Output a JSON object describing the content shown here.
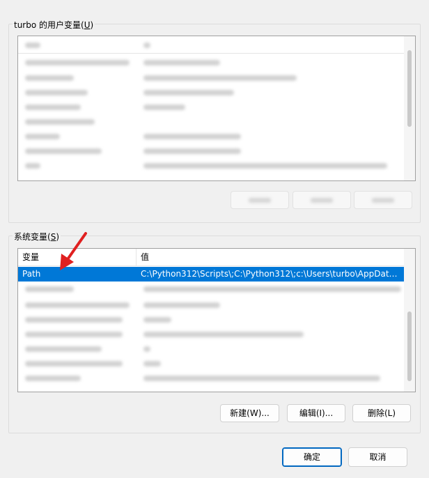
{
  "user_vars": {
    "group_label": "turbo 的用户变量(",
    "group_hotkey": "U",
    "group_label_end": ")"
  },
  "system_vars": {
    "group_label": "系统变量(",
    "group_hotkey": "S",
    "group_label_end": ")",
    "columns": {
      "name": "变量",
      "value": "值"
    },
    "selected_row": {
      "name": "Path",
      "value": "C:\\Python312\\Scripts\\;C:\\Python312\\;c:\\Users\\turbo\\AppData\\..."
    },
    "buttons": {
      "new": "新建(W)...",
      "edit": "编辑(I)...",
      "delete": "删除(L)"
    }
  },
  "footer": {
    "ok": "确定",
    "cancel": "取消"
  },
  "colors": {
    "selection": "#0078d7",
    "annotation_arrow": "#e02020",
    "ok_border": "#0067c0"
  }
}
